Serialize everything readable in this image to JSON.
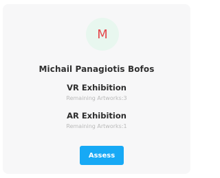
{
  "profile": {
    "avatar_initial": "M",
    "name": "Michail Panagiotis Bofos"
  },
  "exhibitions": [
    {
      "title": "VR Exhibition",
      "remaining": "Remaining Artworks:3"
    },
    {
      "title": "AR Exhibition",
      "remaining": "Remaining Artworks:1"
    }
  ],
  "actions": {
    "assess_label": "Assess"
  },
  "colors": {
    "card_background": "#f7f7f8",
    "avatar_background": "#e8f7ef",
    "avatar_text": "#e5484d",
    "button": "#17a9f5",
    "muted_text": "#b9b9b9"
  }
}
